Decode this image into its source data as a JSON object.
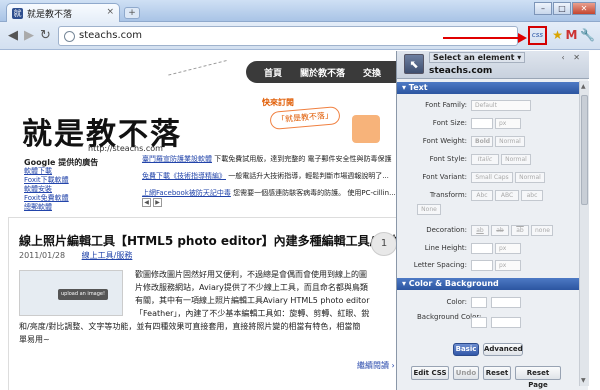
{
  "browser": {
    "tab_title": "就是教不落",
    "tab_close": "×",
    "new_tab": "+",
    "url": "steachs.com",
    "window_buttons": [
      "–",
      "□",
      "✕"
    ],
    "extensions": {
      "css_label": "css",
      "bookmark_star": "★",
      "gmail": "M",
      "tool": "🔧"
    }
  },
  "page": {
    "nav_items": [
      "首頁",
      "關於教不落",
      "交換"
    ],
    "logo_text": "就是教不落",
    "logo_url": "http://steachs.com",
    "follow_label": "快來訂閱",
    "bubble_label": "「就是教不落」",
    "ads": {
      "title": "Google 提供的廣告",
      "items": [
        "軟體下載",
        "Foxit下載軟體",
        "軟體安裝",
        "Foxit免費軟體",
        "總郵軟體"
      ]
    },
    "news": [
      {
        "link": "臺鬥羅宣防護業設軟體",
        "text": "下載免費試用版，達到完整的 電子郵件安全性與防毒保護"
      },
      {
        "link": "免費下載《技術指導精編》",
        "text": "一般電話升大技術指導，輕鬆判斷市場週報說明了..."
      },
      {
        "link": "上網Facebook被防天記中毒",
        "text": "您需要一個感連防駭客病毒的防護。 使用PC-cillin..."
      }
    ],
    "pager": [
      "◀",
      "▶"
    ],
    "post": {
      "title": "線上照片編輯工具【HTML5 photo editor】內建多種編輯工具/特效",
      "date": "2011/01/28",
      "category": "線上工具/服務",
      "comment_count": "1",
      "thumb_button": "upload an image!",
      "body_lines": [
        "歡圖修改圖片固然好用又便利，不過總是會偶而會使用到線上的圖",
        "片修改服務網站，Aviary提供了不少線上工具，而且命名都與鳥類",
        "有關，其中有一項線上照片編輯工具Aviary HTML5 photo editor",
        "「Feather」，內建了不少基本編輯工具如：旋轉、剪轉、紅眼、銳"
      ],
      "body_lines_2": [
        "和/亮度/對比調整、文字等功能，並有四種效果可直接套用，直接將照片變的相當有特色，相當簡",
        "單易用~"
      ],
      "more_link": "繼續閱讀 ›"
    }
  },
  "css_panel": {
    "select_label": "Select an element ▾",
    "domain": "steachs.com",
    "controls": "‹ ✕",
    "text_section": "▾ Text",
    "font_family": {
      "label": "Font Family:",
      "value": "Default"
    },
    "font_size": {
      "label": "Font Size:",
      "unit": "px"
    },
    "font_weight": {
      "label": "Font Weight:",
      "options": [
        "Bold",
        "Normal"
      ]
    },
    "font_style": {
      "label": "Font Style:",
      "options": [
        "Italic",
        "Normal"
      ]
    },
    "font_variant": {
      "label": "Font Variant:",
      "options": [
        "Small Caps",
        "Normal"
      ]
    },
    "transform": {
      "label": "Transform:",
      "options": [
        "Abc",
        "ABC",
        "abc",
        "None"
      ]
    },
    "decoration": {
      "label": "Decoration:",
      "options": [
        "ab",
        "ab",
        "ab",
        "none"
      ]
    },
    "line_height": {
      "label": "Line Height:",
      "unit": "px"
    },
    "letter_spacing": {
      "label": "Letter Spacing:",
      "unit": "px"
    },
    "color_section": "▾ Color & Background",
    "color": {
      "label": "Color:"
    },
    "background_color": {
      "label": "Background Color:"
    },
    "mode_basic": "Basic",
    "mode_advanced": "Advanced",
    "footer": [
      "Edit CSS",
      "Undo",
      "Reset",
      "Reset Page"
    ]
  }
}
